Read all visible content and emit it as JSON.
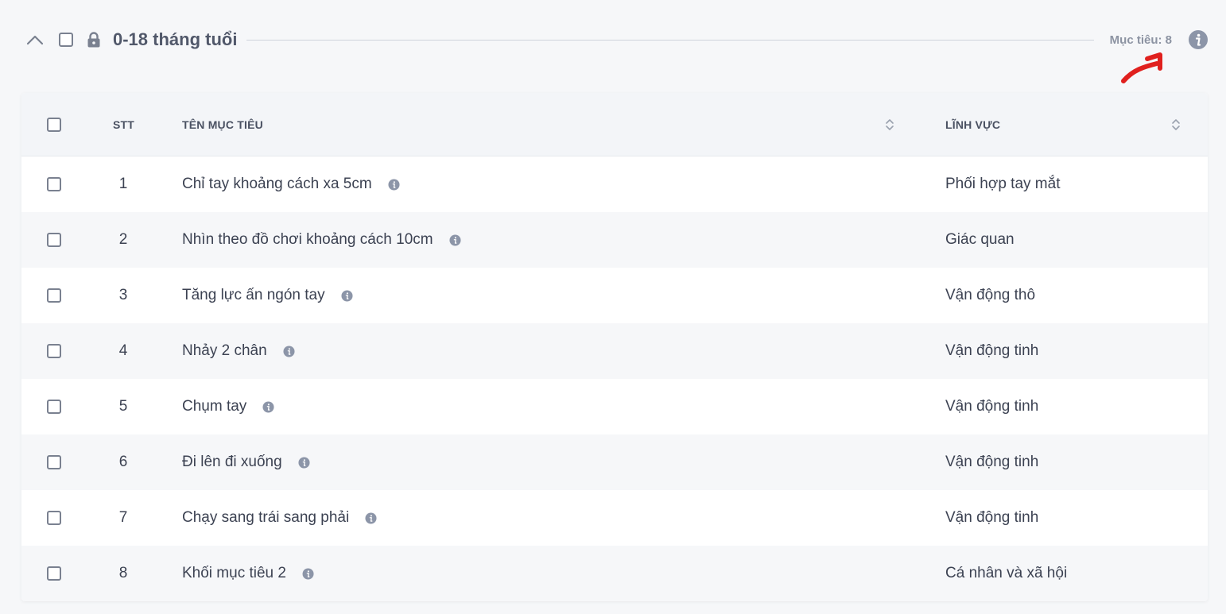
{
  "group": {
    "title": "0-18 tháng tuổi",
    "target_count": "Mục tiêu: 8"
  },
  "table": {
    "headers": {
      "stt": "STT",
      "name": "TÊN MỤC TIÊU",
      "field": "LĨNH VỰC"
    },
    "rows": [
      {
        "stt": "1",
        "name": "Chỉ tay khoảng cách xa 5cm",
        "field": "Phối hợp tay mắt"
      },
      {
        "stt": "2",
        "name": "Nhìn theo đồ chơi khoảng cách 10cm",
        "field": "Giác quan"
      },
      {
        "stt": "3",
        "name": "Tăng lực ấn ngón tay",
        "field": "Vận động thô"
      },
      {
        "stt": "4",
        "name": "Nhảy 2 chân",
        "field": "Vận động tinh"
      },
      {
        "stt": "5",
        "name": "Chụm tay",
        "field": "Vận động tinh"
      },
      {
        "stt": "6",
        "name": "Đi lên đi xuống",
        "field": "Vận động tinh"
      },
      {
        "stt": "7",
        "name": "Chạy sang trái sang phải",
        "field": "Vận động tinh"
      },
      {
        "stt": "8",
        "name": "Khối mục tiêu 2",
        "field": "Cá nhân và xã hội"
      }
    ]
  },
  "icons": {
    "collapse": "chevron-up-icon",
    "lock": "lock-icon",
    "info": "info-icon",
    "sort": "sort-icon",
    "annotation": "red-arrow-annotation"
  },
  "colors": {
    "annotation_arrow": "#e0201e",
    "info_icon": "#8c95a8"
  }
}
